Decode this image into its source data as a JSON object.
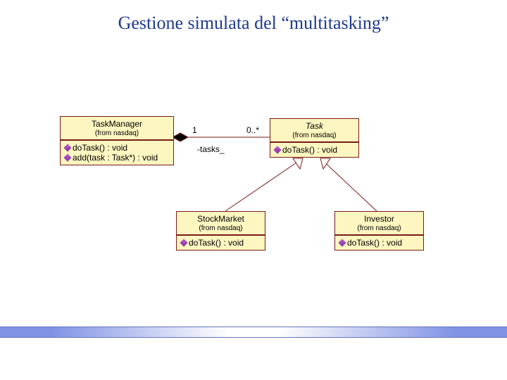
{
  "title": "Gestione simulata del “multitasking”",
  "uml": {
    "taskManager": {
      "name": "TaskManager",
      "from": "(from nasdaq)",
      "ops": [
        "doTask() : void",
        "add(task : Task*) : void"
      ]
    },
    "task": {
      "name": "Task",
      "from": "(from nasdaq)",
      "ops": [
        "doTask() : void"
      ]
    },
    "stockMarket": {
      "name": "StockMarket",
      "from": "(from nasdaq)",
      "ops": [
        "doTask() : void"
      ]
    },
    "investor": {
      "name": "Investor",
      "from": "(from nasdaq)",
      "ops": [
        "doTask() : void"
      ]
    },
    "assoc": {
      "multLeft": "1",
      "multRight": "0..*",
      "role": "-tasks_"
    }
  }
}
